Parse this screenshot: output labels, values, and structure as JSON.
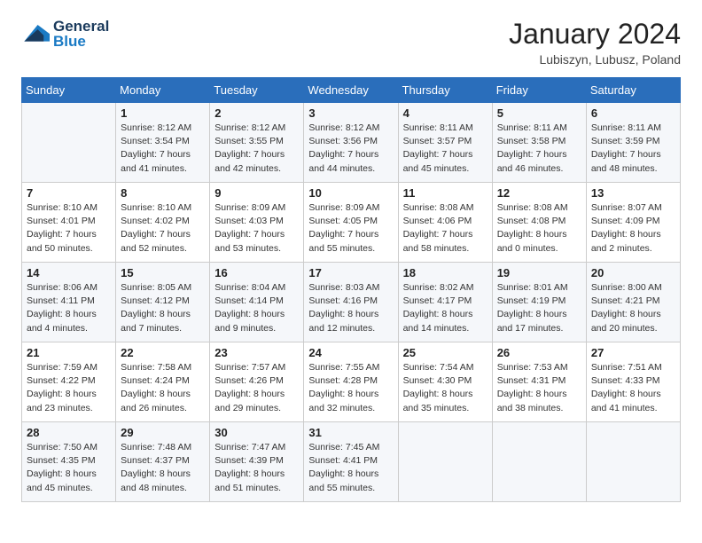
{
  "header": {
    "logo_line1": "General",
    "logo_line2": "Blue",
    "month_title": "January 2024",
    "location": "Lubiszyn, Lubusz, Poland"
  },
  "days_of_week": [
    "Sunday",
    "Monday",
    "Tuesday",
    "Wednesday",
    "Thursday",
    "Friday",
    "Saturday"
  ],
  "weeks": [
    [
      {
        "day": "",
        "sunrise": "",
        "sunset": "",
        "daylight": ""
      },
      {
        "day": "1",
        "sunrise": "Sunrise: 8:12 AM",
        "sunset": "Sunset: 3:54 PM",
        "daylight": "Daylight: 7 hours and 41 minutes."
      },
      {
        "day": "2",
        "sunrise": "Sunrise: 8:12 AM",
        "sunset": "Sunset: 3:55 PM",
        "daylight": "Daylight: 7 hours and 42 minutes."
      },
      {
        "day": "3",
        "sunrise": "Sunrise: 8:12 AM",
        "sunset": "Sunset: 3:56 PM",
        "daylight": "Daylight: 7 hours and 44 minutes."
      },
      {
        "day": "4",
        "sunrise": "Sunrise: 8:11 AM",
        "sunset": "Sunset: 3:57 PM",
        "daylight": "Daylight: 7 hours and 45 minutes."
      },
      {
        "day": "5",
        "sunrise": "Sunrise: 8:11 AM",
        "sunset": "Sunset: 3:58 PM",
        "daylight": "Daylight: 7 hours and 46 minutes."
      },
      {
        "day": "6",
        "sunrise": "Sunrise: 8:11 AM",
        "sunset": "Sunset: 3:59 PM",
        "daylight": "Daylight: 7 hours and 48 minutes."
      }
    ],
    [
      {
        "day": "7",
        "sunrise": "Sunrise: 8:10 AM",
        "sunset": "Sunset: 4:01 PM",
        "daylight": "Daylight: 7 hours and 50 minutes."
      },
      {
        "day": "8",
        "sunrise": "Sunrise: 8:10 AM",
        "sunset": "Sunset: 4:02 PM",
        "daylight": "Daylight: 7 hours and 52 minutes."
      },
      {
        "day": "9",
        "sunrise": "Sunrise: 8:09 AM",
        "sunset": "Sunset: 4:03 PM",
        "daylight": "Daylight: 7 hours and 53 minutes."
      },
      {
        "day": "10",
        "sunrise": "Sunrise: 8:09 AM",
        "sunset": "Sunset: 4:05 PM",
        "daylight": "Daylight: 7 hours and 55 minutes."
      },
      {
        "day": "11",
        "sunrise": "Sunrise: 8:08 AM",
        "sunset": "Sunset: 4:06 PM",
        "daylight": "Daylight: 7 hours and 58 minutes."
      },
      {
        "day": "12",
        "sunrise": "Sunrise: 8:08 AM",
        "sunset": "Sunset: 4:08 PM",
        "daylight": "Daylight: 8 hours and 0 minutes."
      },
      {
        "day": "13",
        "sunrise": "Sunrise: 8:07 AM",
        "sunset": "Sunset: 4:09 PM",
        "daylight": "Daylight: 8 hours and 2 minutes."
      }
    ],
    [
      {
        "day": "14",
        "sunrise": "Sunrise: 8:06 AM",
        "sunset": "Sunset: 4:11 PM",
        "daylight": "Daylight: 8 hours and 4 minutes."
      },
      {
        "day": "15",
        "sunrise": "Sunrise: 8:05 AM",
        "sunset": "Sunset: 4:12 PM",
        "daylight": "Daylight: 8 hours and 7 minutes."
      },
      {
        "day": "16",
        "sunrise": "Sunrise: 8:04 AM",
        "sunset": "Sunset: 4:14 PM",
        "daylight": "Daylight: 8 hours and 9 minutes."
      },
      {
        "day": "17",
        "sunrise": "Sunrise: 8:03 AM",
        "sunset": "Sunset: 4:16 PM",
        "daylight": "Daylight: 8 hours and 12 minutes."
      },
      {
        "day": "18",
        "sunrise": "Sunrise: 8:02 AM",
        "sunset": "Sunset: 4:17 PM",
        "daylight": "Daylight: 8 hours and 14 minutes."
      },
      {
        "day": "19",
        "sunrise": "Sunrise: 8:01 AM",
        "sunset": "Sunset: 4:19 PM",
        "daylight": "Daylight: 8 hours and 17 minutes."
      },
      {
        "day": "20",
        "sunrise": "Sunrise: 8:00 AM",
        "sunset": "Sunset: 4:21 PM",
        "daylight": "Daylight: 8 hours and 20 minutes."
      }
    ],
    [
      {
        "day": "21",
        "sunrise": "Sunrise: 7:59 AM",
        "sunset": "Sunset: 4:22 PM",
        "daylight": "Daylight: 8 hours and 23 minutes."
      },
      {
        "day": "22",
        "sunrise": "Sunrise: 7:58 AM",
        "sunset": "Sunset: 4:24 PM",
        "daylight": "Daylight: 8 hours and 26 minutes."
      },
      {
        "day": "23",
        "sunrise": "Sunrise: 7:57 AM",
        "sunset": "Sunset: 4:26 PM",
        "daylight": "Daylight: 8 hours and 29 minutes."
      },
      {
        "day": "24",
        "sunrise": "Sunrise: 7:55 AM",
        "sunset": "Sunset: 4:28 PM",
        "daylight": "Daylight: 8 hours and 32 minutes."
      },
      {
        "day": "25",
        "sunrise": "Sunrise: 7:54 AM",
        "sunset": "Sunset: 4:30 PM",
        "daylight": "Daylight: 8 hours and 35 minutes."
      },
      {
        "day": "26",
        "sunrise": "Sunrise: 7:53 AM",
        "sunset": "Sunset: 4:31 PM",
        "daylight": "Daylight: 8 hours and 38 minutes."
      },
      {
        "day": "27",
        "sunrise": "Sunrise: 7:51 AM",
        "sunset": "Sunset: 4:33 PM",
        "daylight": "Daylight: 8 hours and 41 minutes."
      }
    ],
    [
      {
        "day": "28",
        "sunrise": "Sunrise: 7:50 AM",
        "sunset": "Sunset: 4:35 PM",
        "daylight": "Daylight: 8 hours and 45 minutes."
      },
      {
        "day": "29",
        "sunrise": "Sunrise: 7:48 AM",
        "sunset": "Sunset: 4:37 PM",
        "daylight": "Daylight: 8 hours and 48 minutes."
      },
      {
        "day": "30",
        "sunrise": "Sunrise: 7:47 AM",
        "sunset": "Sunset: 4:39 PM",
        "daylight": "Daylight: 8 hours and 51 minutes."
      },
      {
        "day": "31",
        "sunrise": "Sunrise: 7:45 AM",
        "sunset": "Sunset: 4:41 PM",
        "daylight": "Daylight: 8 hours and 55 minutes."
      },
      {
        "day": "",
        "sunrise": "",
        "sunset": "",
        "daylight": ""
      },
      {
        "day": "",
        "sunrise": "",
        "sunset": "",
        "daylight": ""
      },
      {
        "day": "",
        "sunrise": "",
        "sunset": "",
        "daylight": ""
      }
    ]
  ]
}
